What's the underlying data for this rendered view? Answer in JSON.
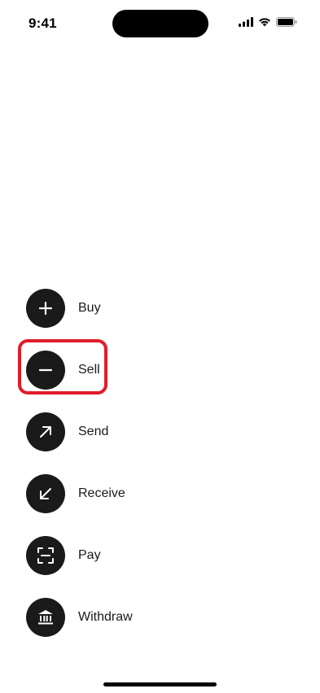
{
  "status_bar": {
    "time": "9:41",
    "icons": [
      "signal-icon",
      "wifi-icon",
      "battery-icon"
    ]
  },
  "actions": [
    {
      "label": "Buy",
      "icon": "plus-icon"
    },
    {
      "label": "Sell",
      "icon": "minus-icon"
    },
    {
      "label": "Send",
      "icon": "arrow-up-right-icon"
    },
    {
      "label": "Receive",
      "icon": "arrow-down-left-icon"
    },
    {
      "label": "Pay",
      "icon": "scan-icon"
    },
    {
      "label": "Withdraw",
      "icon": "bank-icon"
    }
  ],
  "highlight": {
    "target": "Sell",
    "color": "#e11d2a"
  },
  "colors": {
    "icon_background": "#1a1a1a",
    "icon_glyph": "#ffffff",
    "background": "#ffffff"
  }
}
